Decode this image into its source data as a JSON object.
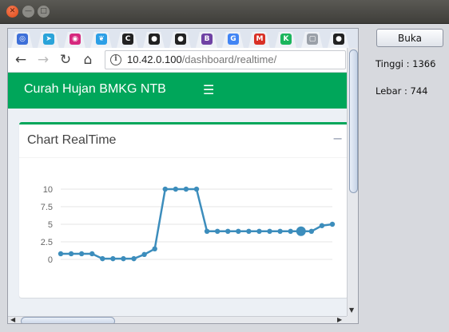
{
  "window": {
    "controls": [
      "close",
      "minimize",
      "maximize"
    ]
  },
  "side_panel": {
    "buka_label": "Buka",
    "tinggi_text": "Tinggi : 1366",
    "lebar_text": "Lebar : 744"
  },
  "browser": {
    "tabs": [
      {
        "icon": "shield-icon",
        "color": "#3d6fd8",
        "glyph": "◎"
      },
      {
        "icon": "telegram-icon",
        "color": "#2aa3d9",
        "glyph": "➤"
      },
      {
        "icon": "instagram-icon",
        "color": "#d6287e",
        "glyph": "◉"
      },
      {
        "icon": "twitter-icon",
        "color": "#2c9fe6",
        "glyph": "❦"
      },
      {
        "icon": "code-icon",
        "color": "#222222",
        "glyph": "C"
      },
      {
        "icon": "github-icon",
        "color": "#222222",
        "glyph": "●"
      },
      {
        "icon": "github-icon",
        "color": "#222222",
        "glyph": "●"
      },
      {
        "icon": "bootstrap-icon",
        "color": "#6f42a4",
        "glyph": "B"
      },
      {
        "icon": "google-icon",
        "color": "#4285f4",
        "glyph": "G"
      },
      {
        "icon": "gmail-icon",
        "color": "#d93025",
        "glyph": "M"
      },
      {
        "icon": "k-icon",
        "color": "#1bb55c",
        "glyph": "K"
      },
      {
        "icon": "document-icon",
        "color": "#9aa0a8",
        "glyph": "▢"
      },
      {
        "icon": "github-icon",
        "color": "#222222",
        "glyph": "●"
      }
    ],
    "url_host": "10.42.0.100",
    "url_path": "/dashboard/realtime/"
  },
  "page": {
    "brand": "Curah Hujan BMKG NTB",
    "accent": "#00a65a",
    "box_title": "Chart RealTime"
  },
  "chart_data": {
    "type": "line",
    "color": "#3c8dbc",
    "y_ticks": [
      "0",
      "2.5",
      "5",
      "7.5",
      "10"
    ],
    "ylim": [
      0,
      10
    ],
    "grid": true,
    "highlight_index": 23,
    "values": [
      0.8,
      0.8,
      0.8,
      0.8,
      0.1,
      0.1,
      0.1,
      0.1,
      0.7,
      1.5,
      10,
      10,
      10,
      10,
      4,
      4,
      4,
      4,
      4,
      4,
      4,
      4,
      4,
      4,
      4,
      4.8,
      5
    ]
  }
}
